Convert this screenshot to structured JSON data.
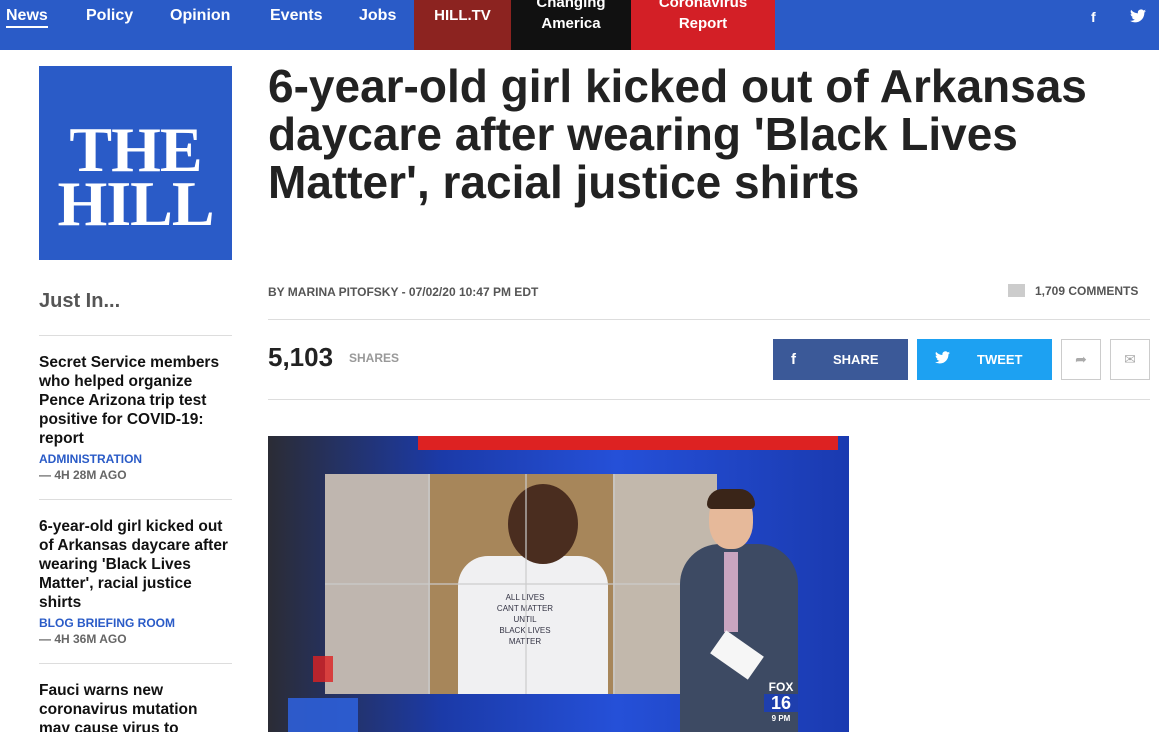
{
  "nav": {
    "items": [
      {
        "label": "News",
        "active": true
      },
      {
        "label": "Policy"
      },
      {
        "label": "Opinion"
      },
      {
        "label": "Events"
      },
      {
        "label": "Jobs"
      }
    ],
    "hilltv": {
      "label": "HILL.TV",
      "color": "#8c2320"
    },
    "changing": {
      "line1": "Changing",
      "line2": "America",
      "color": "#111111"
    },
    "corona": {
      "line1": "Coronavirus",
      "line2": "Report",
      "color": "#d31f26"
    },
    "social": {
      "facebook": "f",
      "twitter": "twitter-icon"
    }
  },
  "brand": {
    "line1": "THE",
    "line2": "HILL",
    "color": "#2a5bc7"
  },
  "sidebar": {
    "heading": "Just In...",
    "items": [
      {
        "title": "Secret Service members who helped organize Pence Arizona trip test positive for COVID-19: report",
        "category": "ADMINISTRATION",
        "time": "— 4H 28M AGO"
      },
      {
        "title": "6-year-old girl kicked out of Arkansas daycare after wearing 'Black Lives Matter', racial justice shirts",
        "category": "BLOG BRIEFING ROOM",
        "time": "— 4H 36M AGO"
      },
      {
        "title": "Fauci warns new coronavirus mutation may cause virus to"
      }
    ]
  },
  "article": {
    "headline": "6-year-old girl kicked out of Arkansas daycare after wearing 'Black Lives Matter', racial justice shirts",
    "byline": "BY MARINA PITOFSKY - 07/02/20 10:47 PM EDT",
    "comments": "1,709 COMMENTS",
    "share_count": "5,103",
    "shares_label": "SHARES",
    "share_button": "SHARE",
    "tweet_button": "TWEET"
  },
  "video": {
    "shirt_lines": [
      "ALL LIVES",
      "CANT MATTER",
      "UNTIL",
      "BLACK LIVES",
      "MATTER"
    ],
    "station": "FOX",
    "channel": "16",
    "time": "9 PM"
  }
}
